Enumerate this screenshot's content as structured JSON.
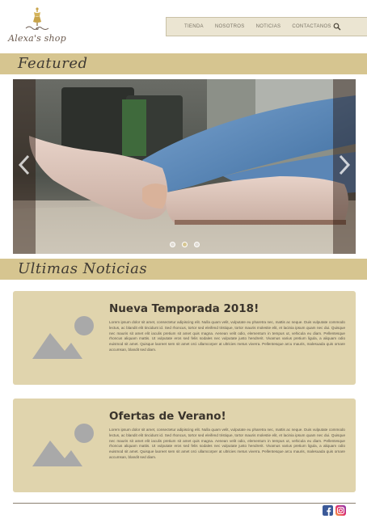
{
  "brand": {
    "name": "Alexa's shop",
    "logo_icon": "dress-form-icon"
  },
  "nav": {
    "items": [
      "TIENDA",
      "NOSOTROS",
      "NOTICIAS",
      "CONTACTANOS"
    ],
    "search_icon": "search-icon"
  },
  "featured": {
    "title": "Featured"
  },
  "carousel": {
    "slide_count": 3,
    "active_slide": 2,
    "prev_icon": "chevron-left-icon",
    "next_icon": "chevron-right-icon"
  },
  "news": {
    "title": "Ultimas Noticias",
    "articles": [
      {
        "title": "Nueva Temporada 2018!",
        "image_icon": "image-placeholder-icon",
        "body": "Lorem ipsum dolor sit amet, consectetur adipiscing elit. Nulla quam velit, vulputate eu pharetra nec, mattis ac neque. Duis vulputate commodo lectus, ac blandit elit tincidunt id. Sed rhoncus, tortor sed eleifend tristique, tortor mauris molestie elit, et lacinia ipsum quam nec dui. Quisque nec mauris sit amet elit iaculis pretium sit amet quis magna. Aenean velit odio, elementum in tempus ut, vehicula eu diam. Pellentesque rhoncus aliquam mattis. Ut vulputate eros sed felis sodales nec vulputate justo hendrerit. Vivamus varius pretium ligula, a aliquam odio euismod sit amet. Quisque laoreet sem sit amet orci ullamcorper at ultricies metus viverra. Pellentesque arcu mauris, malesuada quis ornare accumsan, blandit sed diam."
      },
      {
        "title": "Ofertas de Verano!",
        "image_icon": "image-placeholder-icon",
        "body": "Lorem ipsum dolor sit amet, consectetur adipiscing elit. Nulla quam velit, vulputate eu pharetra nec, mattis ac neque. Duis vulputate commodo lectus, ac blandit elit tincidunt id. Sed rhoncus, tortor sed eleifend tristique, tortor mauris molestie elit, et lacinia ipsum quam nec dui. Quisque nec mauris sit amet elit iaculis pretium sit amet quis magna. Aenean velit odio, elementum in tempus ut, vehicula eu diam. Pellentesque rhoncus aliquam mattis. Ut vulputate eros sed felis sodales nec vulputate justo hendrerit. Vivamus varius pretium ligula, a aliquam odio euismod sit amet. Quisque laoreet sem sit amet orci ullamcorper at ultricies metus viverra. Pellentesque arcu mauris, malesuada quis ornare accumsan, blandit sed diam."
      }
    ]
  },
  "footer": {
    "social": [
      "facebook-icon",
      "instagram-icon"
    ]
  },
  "colors": {
    "accent_band": "#d6c590",
    "card_bg": "#e0d4ad",
    "nav_bg": "#ebe5d2"
  }
}
